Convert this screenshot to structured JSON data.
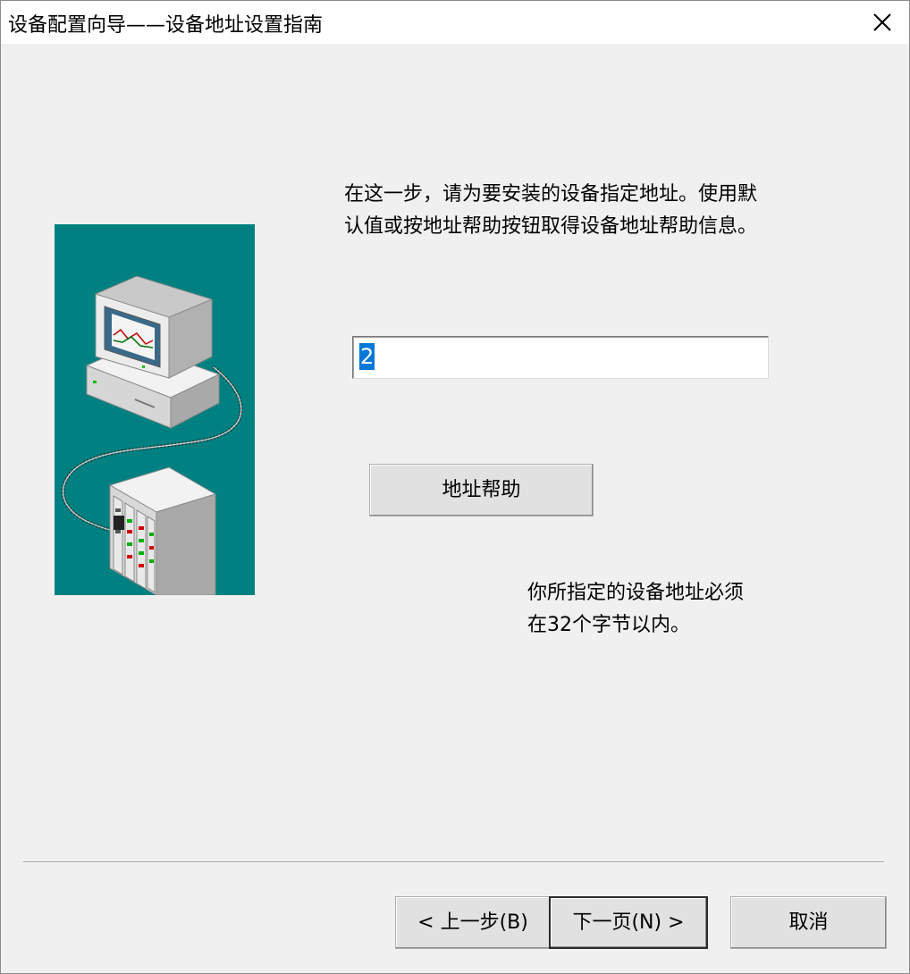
{
  "window": {
    "title": "设备配置向导——设备地址设置指南"
  },
  "instructions": {
    "line1": "在这一步，请为要安装的设备指定地址。使用默",
    "line2": "认值或按地址帮助按钮取得设备地址帮助信息。"
  },
  "address": {
    "value": "2"
  },
  "buttons": {
    "address_help": "地址帮助",
    "back": "< 上一步(B)",
    "next": "下一页(N) >",
    "cancel": "取消"
  },
  "hint": {
    "line1": "你所指定的设备地址必须",
    "line2": "在32个字节以内。"
  },
  "illustration": {
    "background": "#008080",
    "icons": [
      "computer-icon",
      "plc-device-icon"
    ]
  }
}
